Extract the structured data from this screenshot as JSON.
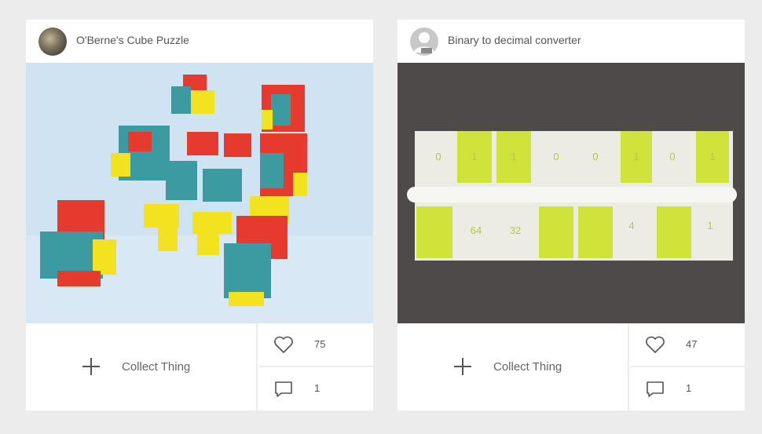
{
  "cards": [
    {
      "title": "O'Berne's Cube Puzzle",
      "collect_label": "Collect Thing",
      "likes": "75",
      "comments": "1"
    },
    {
      "title": "Binary to decimal converter",
      "collect_label": "Collect Thing",
      "likes": "47",
      "comments": "1",
      "image_labels": {
        "top_digits": [
          "0",
          "1",
          "1",
          "0",
          "0",
          "1",
          "0",
          "1"
        ],
        "place_values": [
          "64",
          "32",
          "4",
          "1"
        ]
      }
    }
  ]
}
